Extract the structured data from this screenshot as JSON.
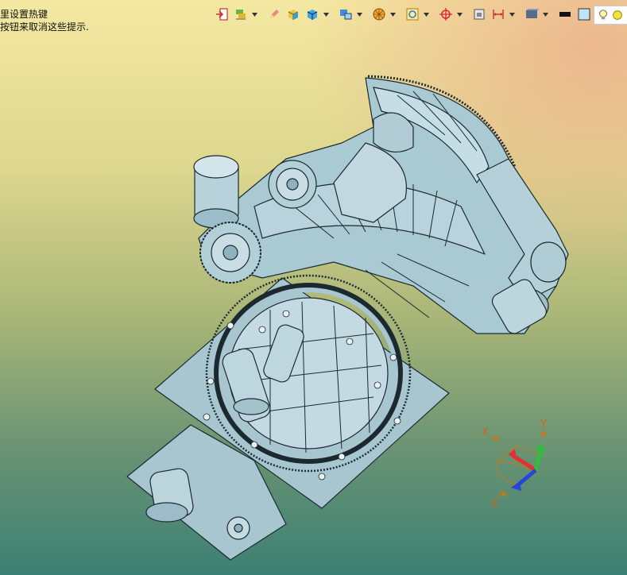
{
  "hint": {
    "line1": "里设置热键",
    "line2": "按钮来取消这些提示."
  },
  "toolbar": {
    "icons": [
      "view-exit-icon",
      "layers-icon",
      "pencil-icon",
      "box-shade-icon",
      "cube-icon",
      "view-orient-icon",
      "sphere-render-icon",
      "zoom-fit-icon",
      "center-target-icon",
      "section-icon",
      "measure-icon",
      "display-mode-icon",
      "line-color-icon",
      "background-icon",
      "layer-stack-icon"
    ]
  },
  "triad": {
    "x_label": "X",
    "y_label": "Y",
    "z_label": "Z"
  },
  "colors": {
    "model_fill": "#a9c9d3",
    "model_stroke": "#1c2a30",
    "axis_x": "#e53030",
    "axis_y": "#2fbf3a",
    "axis_z": "#2547d6",
    "triad_frame": "#c77a14"
  }
}
